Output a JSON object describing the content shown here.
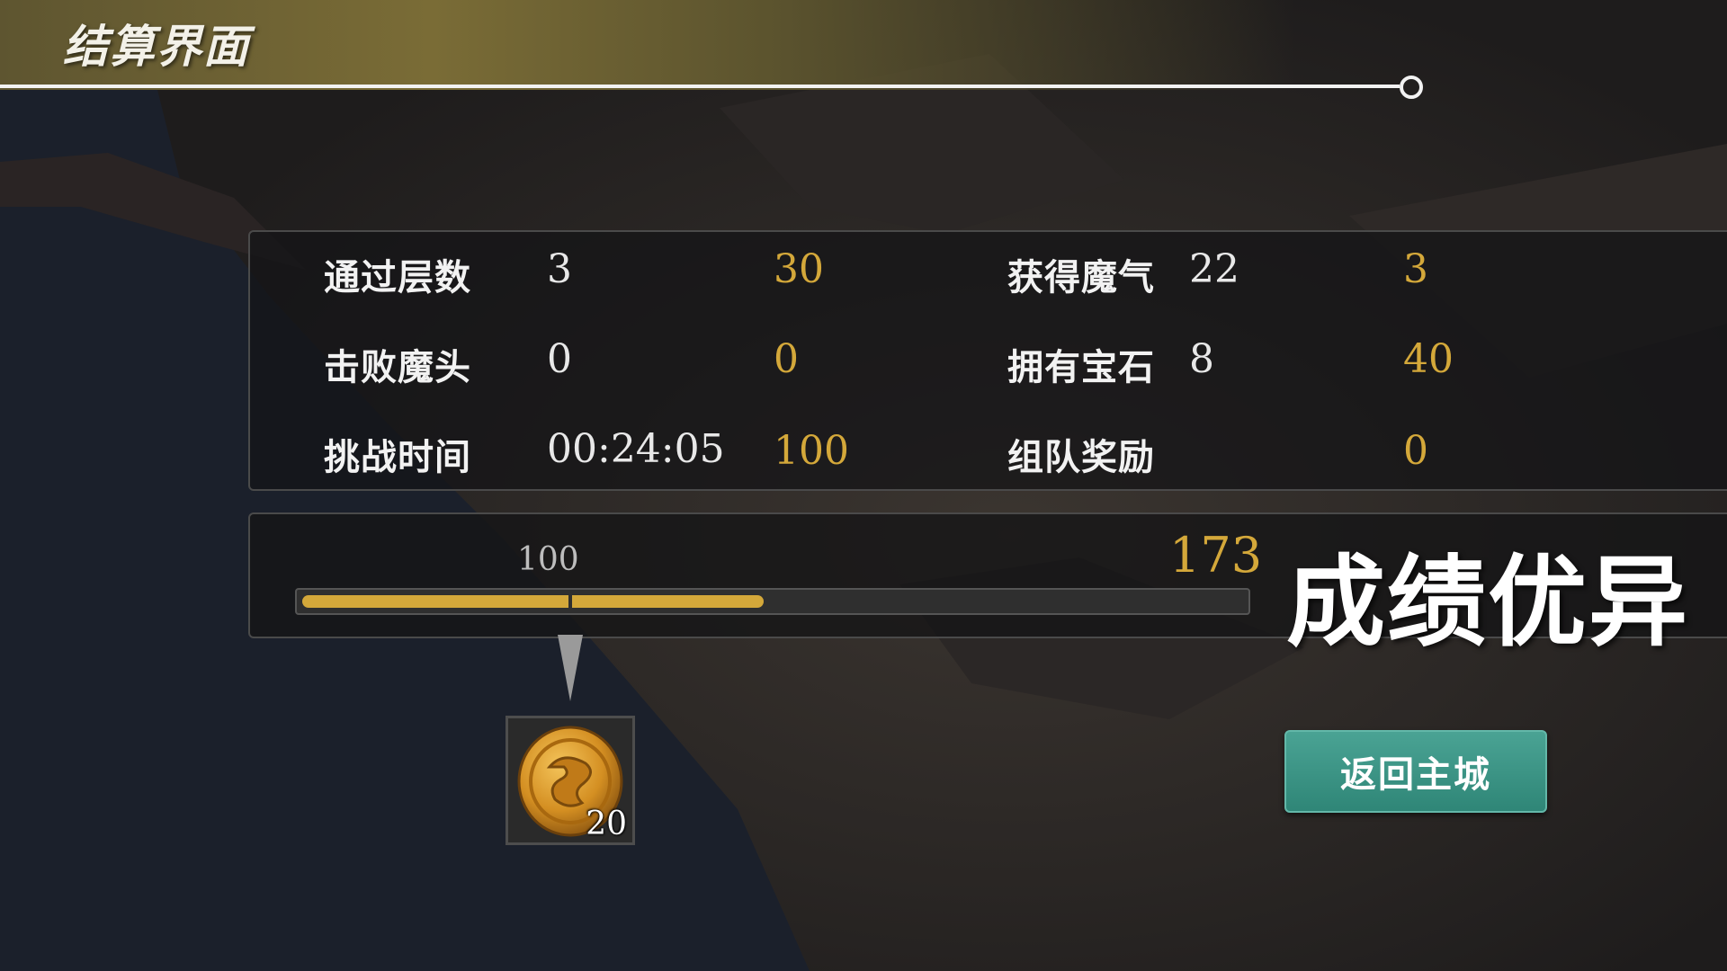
{
  "header": {
    "title": "结算界面"
  },
  "stats": [
    {
      "label": "通过层数",
      "value": "3",
      "bonus": "30"
    },
    {
      "label": "击败魔头",
      "value": "0",
      "bonus": "0"
    },
    {
      "label": "挑战时间",
      "value": "00:24:05",
      "bonus": "100"
    },
    {
      "label": "获得魔气",
      "value": "22",
      "bonus": "3"
    },
    {
      "label": "拥有宝石",
      "value": "8",
      "bonus": "40"
    },
    {
      "label": "组队奖励",
      "value": "",
      "bonus": "0"
    }
  ],
  "score": {
    "threshold": "100",
    "total": "173",
    "progress_fraction": 0.49,
    "grade": "成绩优异"
  },
  "reward": {
    "icon": "gold-coin-icon",
    "count": "20"
  },
  "buttons": {
    "return_label": "返回主城"
  },
  "colors": {
    "accent_gold": "#d4a83a",
    "button_teal": "#3a9585"
  }
}
